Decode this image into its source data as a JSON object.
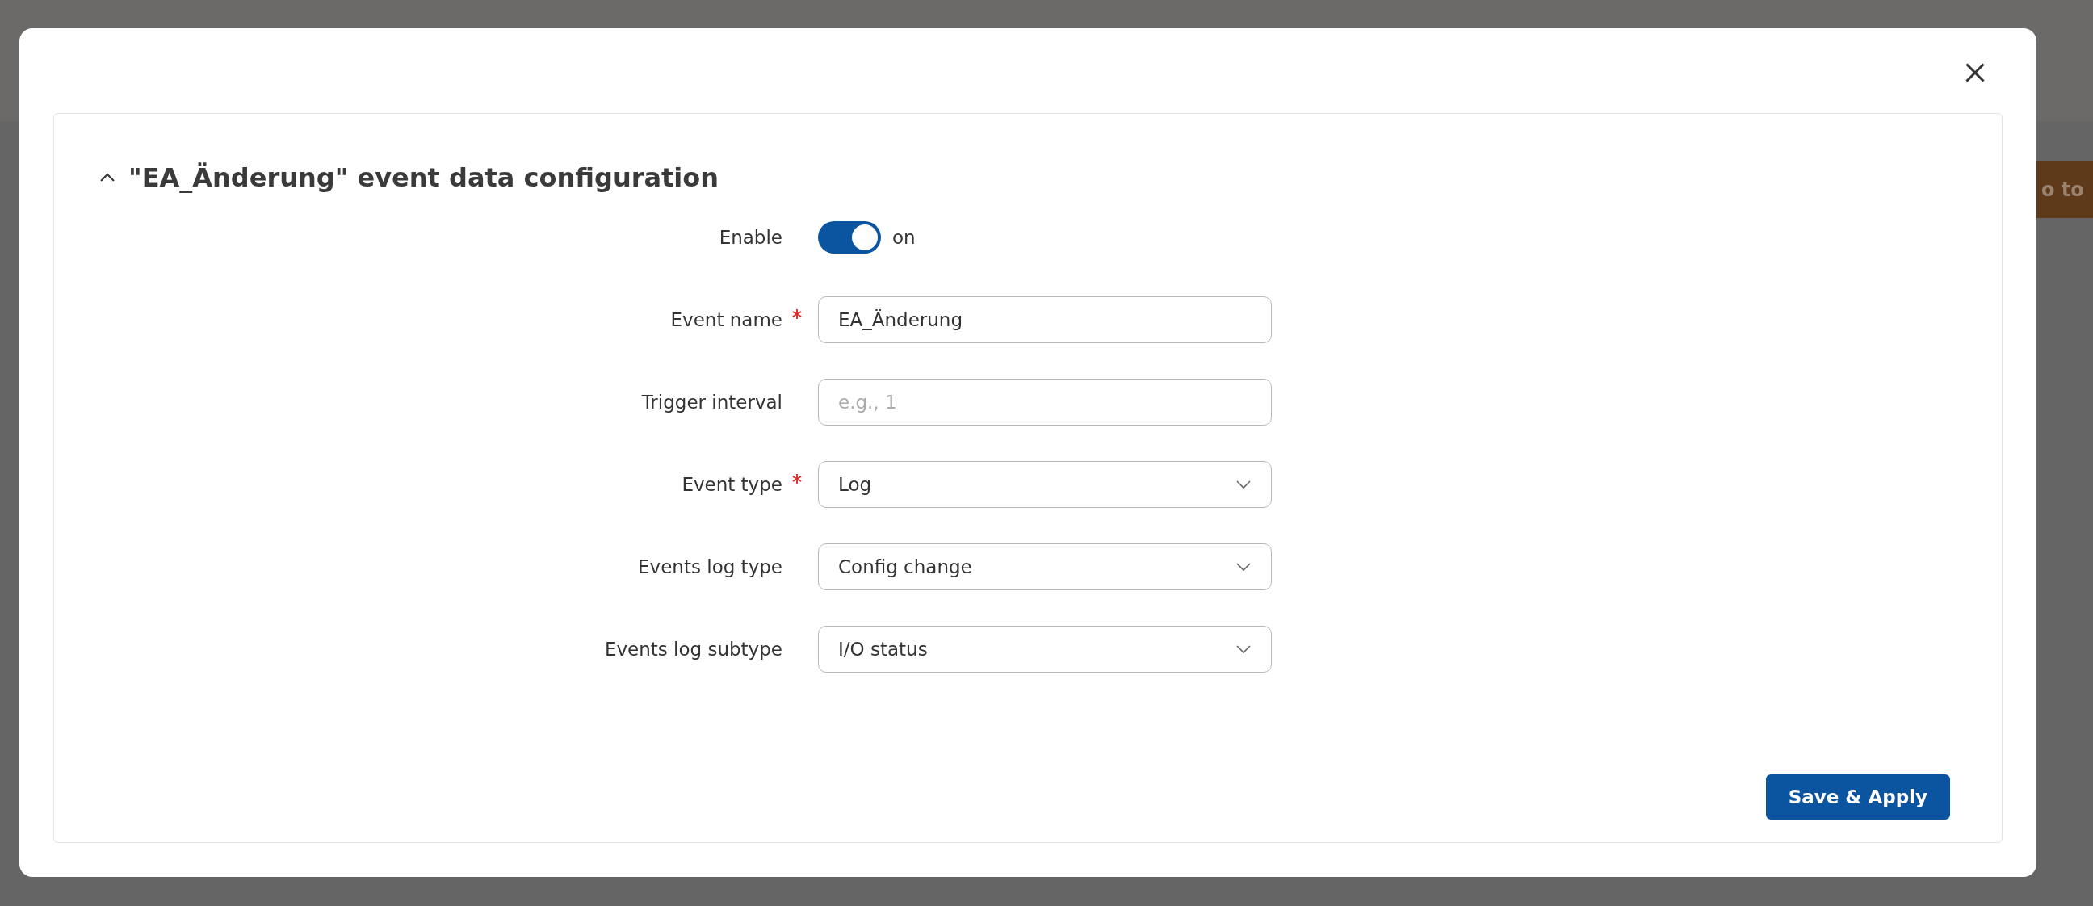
{
  "background_page": {
    "button": "o to"
  },
  "dialog": {
    "title": "\"EA_Änderung\" event data configuration",
    "expanded": true,
    "fields": [
      {
        "kind": "toggle",
        "label": "Enable",
        "required": false,
        "on": true,
        "state_text": "on"
      },
      {
        "kind": "text",
        "label": "Event name",
        "required": true,
        "value": "EA_Änderung"
      },
      {
        "kind": "text",
        "label": "Trigger interval",
        "required": false,
        "placeholder": "e.g., 1"
      },
      {
        "kind": "select",
        "label": "Event type",
        "required": true,
        "value": "Log"
      },
      {
        "kind": "select",
        "label": "Events log type",
        "required": false,
        "value": "Config change"
      },
      {
        "kind": "select",
        "label": "Events log subtype",
        "required": false,
        "value": "I/O status"
      }
    ],
    "save_button": "Save & Apply"
  }
}
